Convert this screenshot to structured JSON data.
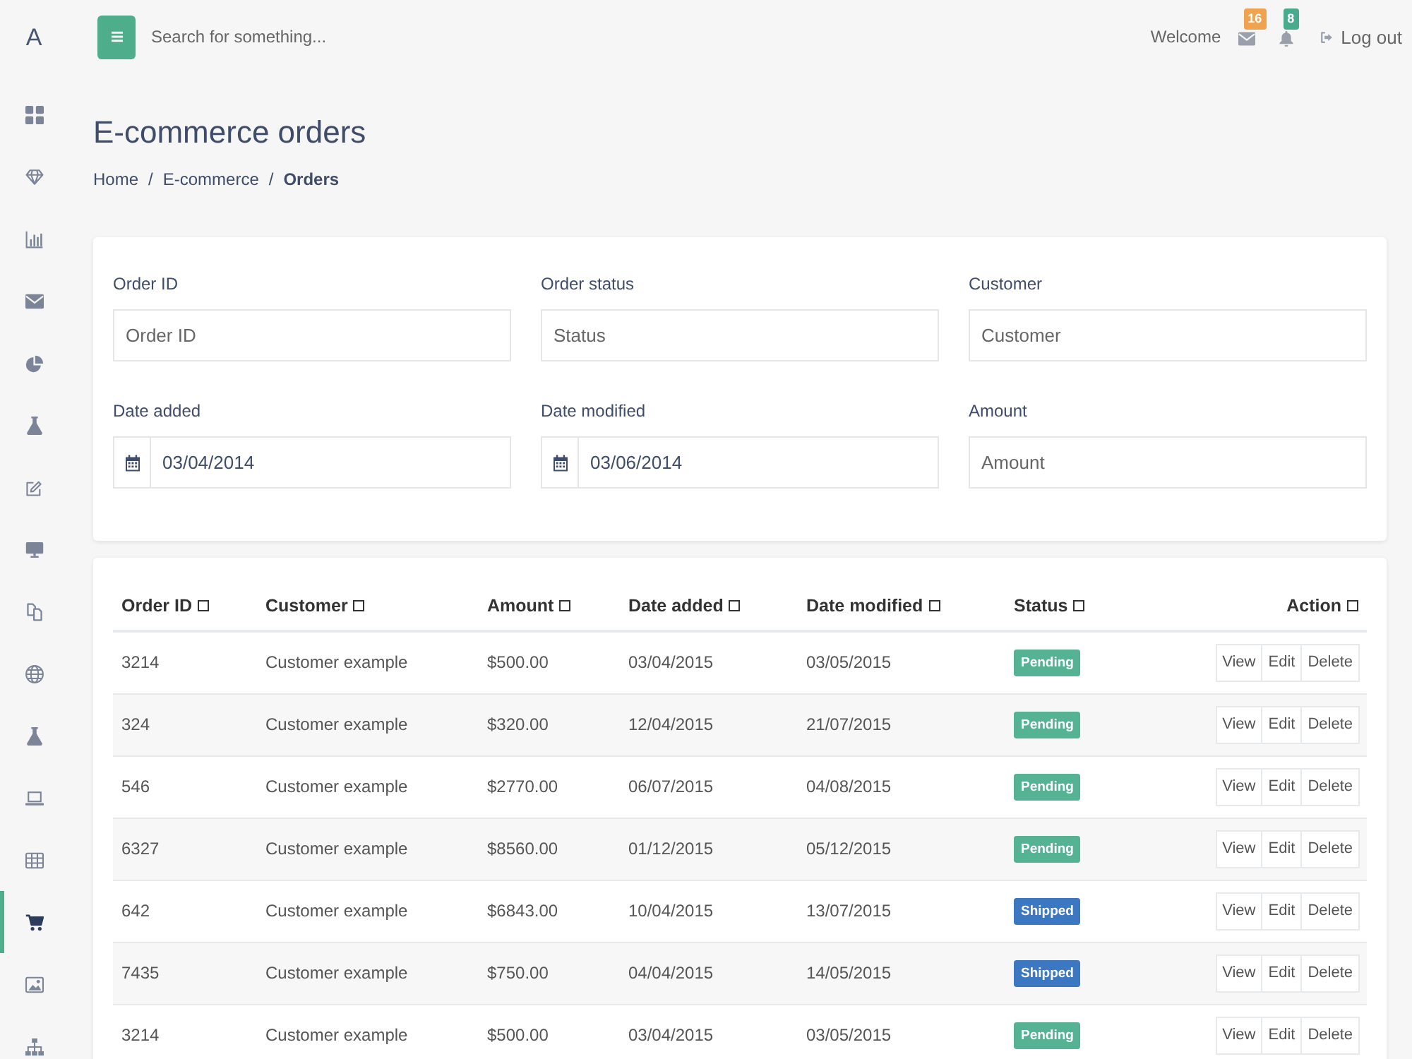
{
  "sidebar": {
    "logo": "A",
    "items": [
      {
        "selected": false
      },
      {
        "selected": false
      },
      {
        "selected": false
      },
      {
        "selected": false
      },
      {
        "selected": false
      },
      {
        "selected": false
      },
      {
        "selected": false
      },
      {
        "selected": false
      },
      {
        "selected": false
      },
      {
        "selected": false
      },
      {
        "selected": false
      },
      {
        "selected": false
      },
      {
        "selected": false
      },
      {
        "selected": true
      },
      {
        "selected": false
      },
      {
        "selected": false
      }
    ]
  },
  "topbar": {
    "search": {
      "placeholder": "Search for something..."
    },
    "welcome": "Welcome",
    "notifications": [
      {
        "count": "16",
        "color": "#efa351"
      },
      {
        "count": "8",
        "color": "#4aab8c"
      }
    ],
    "logout": "Log out"
  },
  "page": {
    "title": "E-commerce orders",
    "breadcrumb": [
      {
        "kind": "link",
        "text": "Home"
      },
      {
        "kind": "separator",
        "text": "/"
      },
      {
        "kind": "link",
        "text": "E-commerce"
      },
      {
        "kind": "separator",
        "text": "/"
      },
      {
        "kind": "current",
        "text": "Orders"
      }
    ]
  },
  "filters": [
    {
      "kind": "text",
      "label": "Order ID",
      "placeholder": "Order ID"
    },
    {
      "kind": "text",
      "label": "Order status",
      "placeholder": "Status"
    },
    {
      "kind": "text",
      "label": "Customer",
      "placeholder": "Customer"
    },
    {
      "kind": "date",
      "label": "Date added",
      "value": "03/04/2014"
    },
    {
      "kind": "date",
      "label": "Date modified",
      "value": "03/06/2014"
    },
    {
      "kind": "text",
      "label": "Amount",
      "placeholder": "Amount"
    }
  ],
  "table": {
    "columns": [
      "Order ID",
      "Customer",
      "Amount",
      "Date added",
      "Date modified",
      "Status",
      "Action"
    ],
    "rows": [
      {
        "order_id": "3214",
        "customer": "Customer example",
        "amount": "$500.00",
        "date_added": "03/04/2015",
        "date_modified": "03/05/2015",
        "status": {
          "label": "Pending",
          "color": "#55b293"
        },
        "actions": [
          "View",
          "Edit",
          "Delete"
        ]
      },
      {
        "order_id": "324",
        "customer": "Customer example",
        "amount": "$320.00",
        "date_added": "12/04/2015",
        "date_modified": "21/07/2015",
        "status": {
          "label": "Pending",
          "color": "#55b293"
        },
        "actions": [
          "View",
          "Edit",
          "Delete"
        ]
      },
      {
        "order_id": "546",
        "customer": "Customer example",
        "amount": "$2770.00",
        "date_added": "06/07/2015",
        "date_modified": "04/08/2015",
        "status": {
          "label": "Pending",
          "color": "#55b293"
        },
        "actions": [
          "View",
          "Edit",
          "Delete"
        ]
      },
      {
        "order_id": "6327",
        "customer": "Customer example",
        "amount": "$8560.00",
        "date_added": "01/12/2015",
        "date_modified": "05/12/2015",
        "status": {
          "label": "Pending",
          "color": "#55b293"
        },
        "actions": [
          "View",
          "Edit",
          "Delete"
        ]
      },
      {
        "order_id": "642",
        "customer": "Customer example",
        "amount": "$6843.00",
        "date_added": "10/04/2015",
        "date_modified": "13/07/2015",
        "status": {
          "label": "Shipped",
          "color": "#3b78c1"
        },
        "actions": [
          "View",
          "Edit",
          "Delete"
        ]
      },
      {
        "order_id": "7435",
        "customer": "Customer example",
        "amount": "$750.00",
        "date_added": "04/04/2015",
        "date_modified": "14/05/2015",
        "status": {
          "label": "Shipped",
          "color": "#3b78c1"
        },
        "actions": [
          "View",
          "Edit",
          "Delete"
        ]
      },
      {
        "order_id": "3214",
        "customer": "Customer example",
        "amount": "$500.00",
        "date_added": "03/04/2015",
        "date_modified": "03/05/2015",
        "status": {
          "label": "Pending",
          "color": "#55b293"
        },
        "actions": [
          "View",
          "Edit",
          "Delete"
        ]
      }
    ]
  }
}
